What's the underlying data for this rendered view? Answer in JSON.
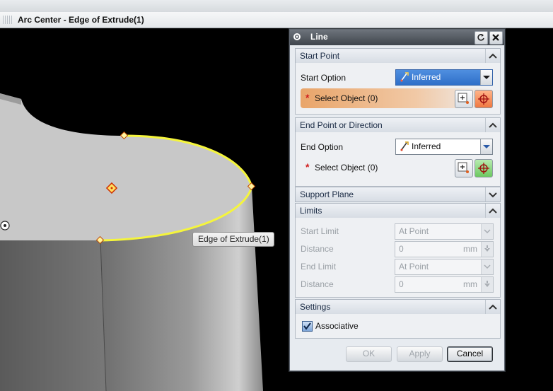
{
  "window": {
    "status_text": "Arc Center - Edge of Extrude(1)"
  },
  "viewport": {
    "tooltip": "Edge of Extrude(1)",
    "highlight_color": "#f5f53c",
    "model_color": "#c8c8c8"
  },
  "dialog": {
    "title": "Line",
    "start_point": {
      "header": "Start Point",
      "option_label": "Start Option",
      "option_value": "Inferred",
      "select_label": "Select Object (0)"
    },
    "end_point": {
      "header": "End Point or Direction",
      "option_label": "End Option",
      "option_value": "Inferred",
      "select_label": "Select Object (0)"
    },
    "support_plane": {
      "header": "Support Plane"
    },
    "limits": {
      "header": "Limits",
      "start_limit_label": "Start Limit",
      "start_limit_value": "At Point",
      "distance1_label": "Distance",
      "distance1_value": "0",
      "distance1_unit": "mm",
      "end_limit_label": "End Limit",
      "end_limit_value": "At Point",
      "distance2_label": "Distance",
      "distance2_value": "0",
      "distance2_unit": "mm"
    },
    "settings": {
      "header": "Settings",
      "associative_label": "Associative",
      "associative_checked": true
    },
    "buttons": {
      "ok": "OK",
      "apply": "Apply",
      "cancel": "Cancel"
    }
  }
}
